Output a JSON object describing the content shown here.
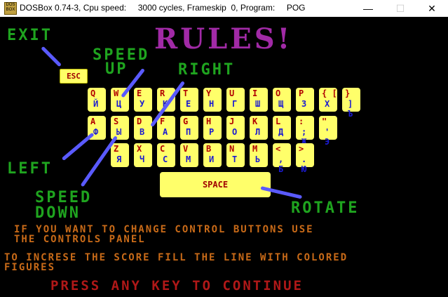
{
  "window": {
    "icon_text": "DOS BOX",
    "title": "DOSBox 0.74-3, Cpu speed:     3000 cycles, Frameskip  0, Program:     POG",
    "minimize": "—",
    "maximize": "☐",
    "close": "✕"
  },
  "screen": {
    "title": "RULES!",
    "labels": {
      "exit": "EXIT",
      "speed_up_1": "SPEED",
      "speed_up_2": "UP",
      "right": "RIGHT",
      "left": "LEFT",
      "speed_down_1": "SPEED",
      "speed_down_2": "DOWN",
      "rotate": "ROTATE"
    },
    "esc_key": "ESC",
    "keyboard": {
      "row1": [
        {
          "lat": "Q",
          "cyr": "Й"
        },
        {
          "lat": "W",
          "cyr": "Ц"
        },
        {
          "lat": "E",
          "cyr": "У"
        },
        {
          "lat": "R",
          "cyr": "К"
        },
        {
          "lat": "T",
          "cyr": "Е"
        },
        {
          "lat": "Y",
          "cyr": "Н"
        },
        {
          "lat": "U",
          "cyr": "Г"
        },
        {
          "lat": "I",
          "cyr": "Ш"
        },
        {
          "lat": "O",
          "cyr": "Щ"
        },
        {
          "lat": "P",
          "cyr": "З"
        },
        {
          "lat": "{ [",
          "cyr": "Х"
        },
        {
          "lat": "}",
          "cyr": "] Ъ"
        }
      ],
      "row2": [
        {
          "lat": "A",
          "cyr": "Ф"
        },
        {
          "lat": "S",
          "cyr": "Ы"
        },
        {
          "lat": "D",
          "cyr": "В"
        },
        {
          "lat": "F",
          "cyr": "А"
        },
        {
          "lat": "G",
          "cyr": "П"
        },
        {
          "lat": "H",
          "cyr": "Р"
        },
        {
          "lat": "J",
          "cyr": "О"
        },
        {
          "lat": "K",
          "cyr": "Л"
        },
        {
          "lat": "L",
          "cyr": "Д"
        },
        {
          "lat": ":",
          "cyr": "; Ж"
        },
        {
          "lat": "\"",
          "cyr": "' Э"
        }
      ],
      "row3": [
        {
          "lat": "Z",
          "cyr": "Я"
        },
        {
          "lat": "X",
          "cyr": "Ч"
        },
        {
          "lat": "C",
          "cyr": "С"
        },
        {
          "lat": "V",
          "cyr": "М"
        },
        {
          "lat": "B",
          "cyr": "И"
        },
        {
          "lat": "N",
          "cyr": "Т"
        },
        {
          "lat": "M",
          "cyr": "Ь"
        },
        {
          "lat": "<",
          "cyr": ", Б"
        },
        {
          "lat": ">",
          "cyr": ". Ю"
        }
      ]
    },
    "space_key": "SPACE",
    "info_1_line1": "IF YOU WANT TO CHANGE CONTROL BUTTONS USE",
    "info_1_line2": "THE CONTROLS PANEL",
    "info_2_line1": "TO INCRESE THE SCORE FILL THE LINE WITH COLORED",
    "info_2_line2": "FIGURES",
    "press_key": "PRESS ANY KEY TO CONTINUE",
    "colors": {
      "title": "#a12aa6",
      "labels": "#1fa41f",
      "key_face": "#ffff6a",
      "key_latin": "#b00000",
      "key_cyrillic": "#1a1ad0",
      "pointers": "#5a5aff",
      "info": "#c86a18",
      "press": "#b01818"
    }
  }
}
